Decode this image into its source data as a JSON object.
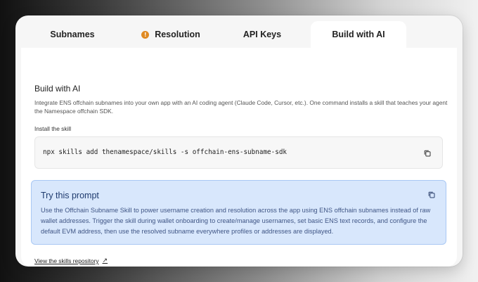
{
  "tabs": [
    {
      "label": "Subnames",
      "active": false
    },
    {
      "label": "Resolution",
      "active": false,
      "icon": "warning-icon",
      "icon_glyph": "!",
      "icon_color": "#e08a23"
    },
    {
      "label": "API Keys",
      "active": false
    },
    {
      "label": "Build with AI",
      "active": true
    }
  ],
  "section": {
    "title": "Build with AI",
    "description": "Integrate ENS offchain subnames into your own app with an AI coding agent (Claude Code, Cursor, etc.). One command installs a skill that teaches your agent the Namespace offchain SDK."
  },
  "install": {
    "label": "Install the skill",
    "command": "npx skills add thenamespace/skills -s offchain-ens-subname-sdk",
    "copy_icon": "copy-icon"
  },
  "prompt": {
    "title": "Try this prompt",
    "body": "Use the Offchain Subname Skill to power username creation and resolution across the app using ENS offchain subnames instead of raw wallet addresses. Trigger the skill during wallet onboarding to create/manage usernames, set basic ENS text records, and configure the default EVM address, then use the resolved subname everywhere profiles or addresses are displayed.",
    "copy_icon": "copy-icon",
    "background": "#d8e7fc",
    "border": "#a9c8f4"
  },
  "repo_link": {
    "label": "View the skills repository",
    "icon": "external-arrow-icon",
    "glyph": "↗"
  }
}
